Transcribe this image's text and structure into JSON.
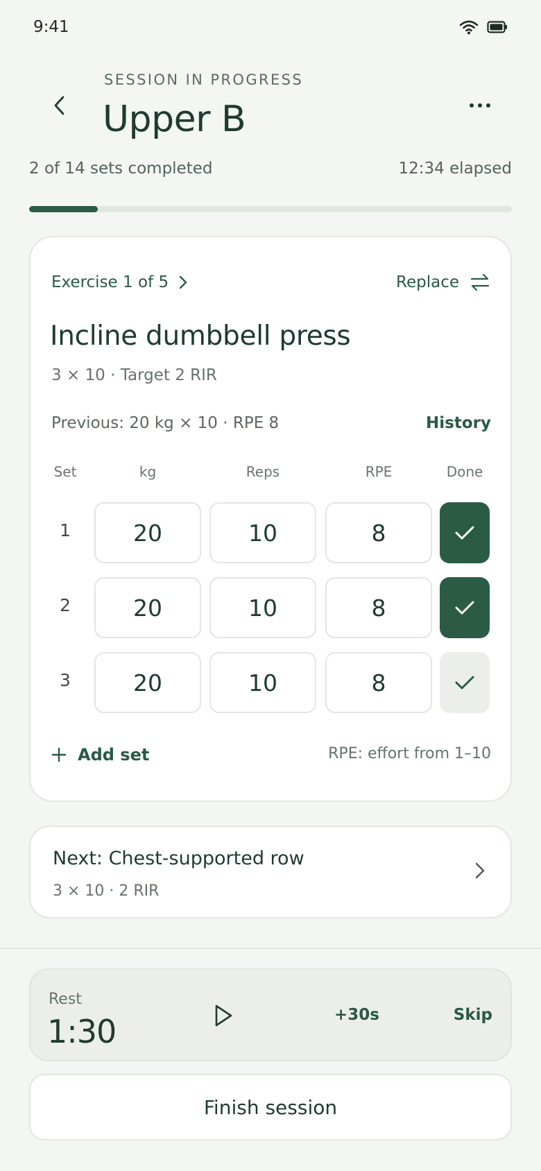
{
  "status_bar": {
    "time": "9:41",
    "icons": [
      "wifi-icon",
      "battery-icon"
    ]
  },
  "header": {
    "eyebrow": "SESSION IN PROGRESS",
    "title": "Upper B",
    "back_icon": "chevron-left-icon",
    "more_icon": "more-horizontal-icon"
  },
  "progress": {
    "text": "2 of 14 sets completed",
    "elapsed": "12:34 elapsed",
    "completed_fraction": 0.142857
  },
  "exercise": {
    "nav_label": "Exercise 1 of 5",
    "replace_label": "Replace",
    "name": "Incline dumbbell press",
    "scheme": "3 × 10 · Target 2 RIR",
    "previous": "Previous: 20 kg × 10 · RPE 8",
    "history_label": "History",
    "columns": {
      "set": "Set",
      "kg": "kg",
      "reps": "Reps",
      "rpe": "RPE",
      "done": "Done"
    },
    "sets": [
      {
        "set": "1",
        "kg": "20",
        "reps": "10",
        "rpe": "8",
        "done": true
      },
      {
        "set": "2",
        "kg": "20",
        "reps": "10",
        "rpe": "8",
        "done": true
      },
      {
        "set": "3",
        "kg": "20",
        "reps": "10",
        "rpe": "8",
        "done": false
      }
    ],
    "add_set_label": "Add set",
    "rpe_note": "RPE: effort from 1–10"
  },
  "next": {
    "title": "Next: Chest-supported row",
    "scheme": "3 × 10 · 2 RIR"
  },
  "rest": {
    "label": "Rest",
    "time": "1:30",
    "add_label": "+30s",
    "skip_label": "Skip"
  },
  "finish_label": "Finish session",
  "colors": {
    "accent": "#2b5b45",
    "background": "#f3f6f2",
    "card": "#ffffff",
    "muted": "#66726b"
  }
}
